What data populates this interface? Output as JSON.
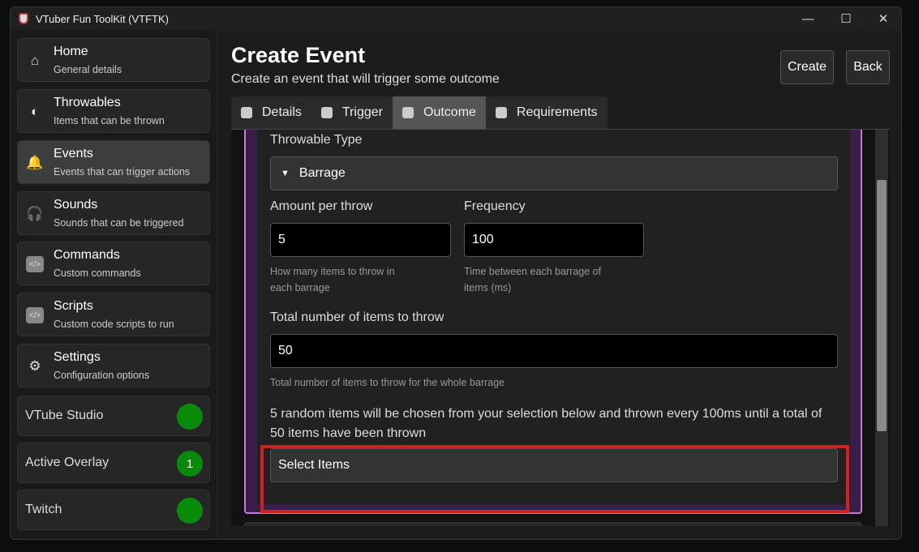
{
  "window": {
    "title": "VTuber Fun ToolKit (VTFTK)",
    "minimize": "—",
    "maximize": "☐",
    "close": "✕"
  },
  "sidebar": {
    "items": [
      {
        "label": "Home",
        "desc": "General details",
        "icon": "⌂"
      },
      {
        "label": "Throwables",
        "desc": "Items that can be thrown",
        "icon": "◐"
      },
      {
        "label": "Events",
        "desc": "Events that can trigger actions",
        "icon": "🔔"
      },
      {
        "label": "Sounds",
        "desc": "Sounds that can be triggered",
        "icon": "🎧"
      },
      {
        "label": "Commands",
        "desc": "Custom commands",
        "icon": "</>"
      },
      {
        "label": "Scripts",
        "desc": "Custom code scripts to run",
        "icon": "</>"
      },
      {
        "label": "Settings",
        "desc": "Configuration options",
        "icon": "⚙"
      }
    ],
    "status": [
      {
        "label": "VTube Studio",
        "badge": ""
      },
      {
        "label": "Active Overlay",
        "badge": "1"
      },
      {
        "label": "Twitch",
        "badge": ""
      }
    ],
    "status_color": "#0a8a0a"
  },
  "header": {
    "title": "Create Event",
    "subtitle": "Create an event that will trigger some outcome",
    "create": "Create",
    "back": "Back"
  },
  "tabs": [
    {
      "label": "Details"
    },
    {
      "label": "Trigger"
    },
    {
      "label": "Outcome"
    },
    {
      "label": "Requirements"
    }
  ],
  "form": {
    "throwable_type_label": "Throwable Type",
    "throwable_type_value": "Barrage",
    "dropdown_arrow": "▼",
    "amount_label": "Amount per throw",
    "amount_value": "5",
    "amount_help": "How many items to throw in each barrage",
    "frequency_label": "Frequency",
    "frequency_value": "100",
    "frequency_help": "Time between each barrage of items (ms)",
    "total_label": "Total number of items to throw",
    "total_value": "50",
    "total_help": "Total number of items to throw for the whole barrage",
    "summary": "5 random items will be chosen from your selection below and thrown every 100ms until a total of 50 items have been thrown",
    "select_items": "Select Items"
  },
  "colors": {
    "accent_border": "#c07ad8",
    "highlight": "#d21f1f"
  }
}
